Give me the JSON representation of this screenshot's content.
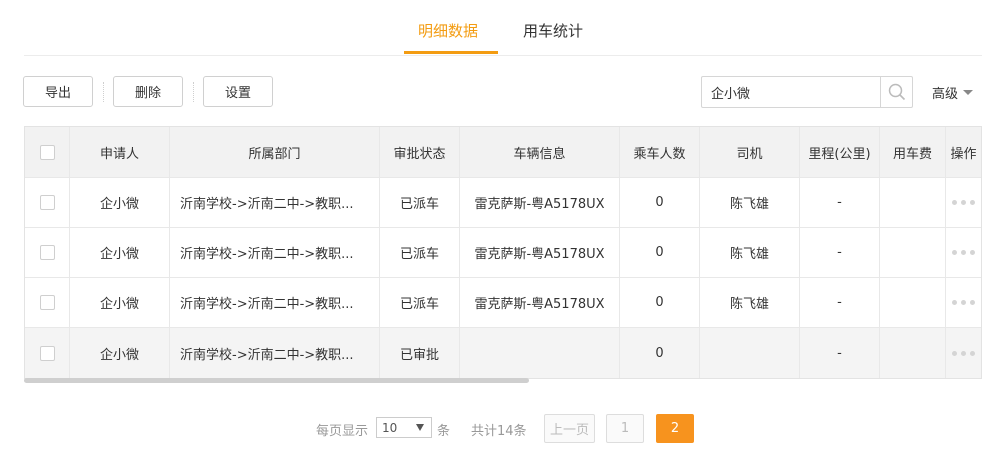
{
  "tabs": [
    {
      "label": "明细数据",
      "active": true
    },
    {
      "label": "用车统计",
      "active": false
    }
  ],
  "toolbar": {
    "export_label": "导出",
    "delete_label": "删除",
    "settings_label": "设置"
  },
  "search": {
    "value": "企小微",
    "placeholder": ""
  },
  "advanced_label": "高级",
  "table": {
    "headers": [
      "",
      "申请人",
      "所属部门",
      "审批状态",
      "车辆信息",
      "乘车人数",
      "司机",
      "里程(公里)",
      "用车费",
      "操作"
    ],
    "rows": [
      {
        "applicant": "企小微",
        "department": "沂南学校->沂南二中->教职...",
        "status": "已派车",
        "vehicle": "雷克萨斯-粤A5178UX",
        "passengers": "0",
        "driver": "陈飞雄",
        "mileage": "-",
        "fee": ""
      },
      {
        "applicant": "企小微",
        "department": "沂南学校->沂南二中->教职...",
        "status": "已派车",
        "vehicle": "雷克萨斯-粤A5178UX",
        "passengers": "0",
        "driver": "陈飞雄",
        "mileage": "-",
        "fee": ""
      },
      {
        "applicant": "企小微",
        "department": "沂南学校->沂南二中->教职...",
        "status": "已派车",
        "vehicle": "雷克萨斯-粤A5178UX",
        "passengers": "0",
        "driver": "陈飞雄",
        "mileage": "-",
        "fee": ""
      },
      {
        "applicant": "企小微",
        "department": "沂南学校->沂南二中->教职...",
        "status": "已审批",
        "vehicle": "",
        "passengers": "0",
        "driver": "",
        "mileage": "-",
        "fee": ""
      }
    ]
  },
  "pagination": {
    "per_page_label": "每页显示",
    "per_page_value": "10",
    "unit_label": "条",
    "total_label": "共计14条",
    "prev_label": "上一页",
    "pages": [
      "1",
      "2"
    ],
    "current_page": "2"
  },
  "colors": {
    "accent": "#f39c12",
    "active_page": "#f7931e"
  }
}
